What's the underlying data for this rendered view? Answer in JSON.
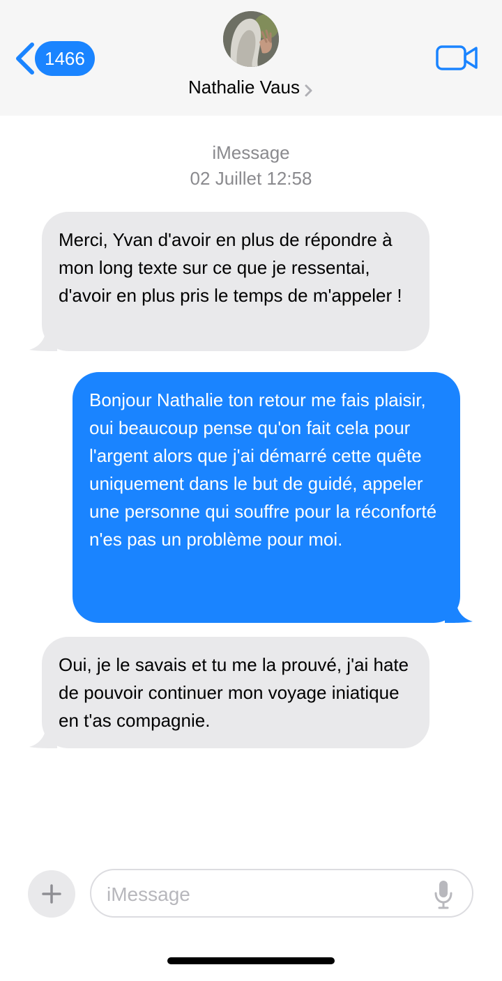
{
  "header": {
    "back_count": "1466",
    "contact_name": "Nathalie Vaus",
    "icons": {
      "back": "chevron-left-icon",
      "video": "video-camera-icon",
      "contact": "chevron-right-icon"
    },
    "accent": "#1a84ff"
  },
  "conversation": {
    "service": "iMessage",
    "timestamp": "02 Juillet 12:58",
    "messages": [
      {
        "direction": "incoming",
        "text": "Merci, Yvan d'avoir en plus de répondre à mon long texte sur ce que je ressentai, d'avoir en plus pris le temps de m'appeler !"
      },
      {
        "direction": "outgoing",
        "text": "Bonjour Nathalie ton retour me fais plaisir, oui beaucoup pense qu'on fait cela pour l'argent alors que j'ai démarré cette quête uniquement dans le but de guidé, appeler une personne qui souffre pour la réconforté n'es pas un problème pour moi."
      },
      {
        "direction": "incoming",
        "text": "Oui, je le savais et tu me la prouvé, j'ai hate de pouvoir continuer mon voyage iniatique en t'as compagnie."
      }
    ],
    "colors": {
      "incoming_bg": "#e9e9eb",
      "outgoing_bg": "#1a84ff"
    }
  },
  "composer": {
    "placeholder": "iMessage",
    "icons": {
      "add": "plus-icon",
      "mic": "microphone-icon"
    }
  }
}
